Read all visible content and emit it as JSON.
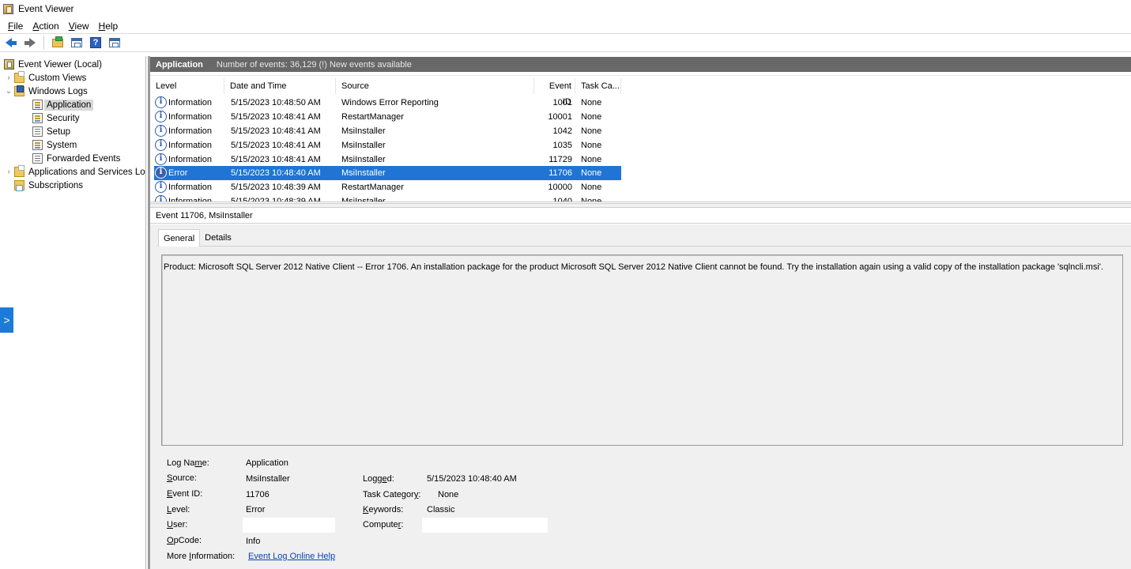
{
  "window": {
    "title": "Event Viewer"
  },
  "menu": [
    {
      "label": "File",
      "key": "F",
      "rest": "ile"
    },
    {
      "label": "Action",
      "key": "A",
      "rest": "ction"
    },
    {
      "label": "View",
      "key": "V",
      "rest": "iew"
    },
    {
      "label": "Help",
      "key": "H",
      "rest": "elp"
    }
  ],
  "toolbar": {
    "icons": [
      "back-arrow-icon",
      "forward-arrow-icon",
      "open-folder-icon",
      "properties-icon",
      "help-icon",
      "show-hide-pane-icon"
    ],
    "help_glyph": "?"
  },
  "tree": {
    "root": "Event Viewer (Local)",
    "custom_views": "Custom Views",
    "windows_logs": "Windows Logs",
    "application": "Application",
    "security": "Security",
    "setup": "Setup",
    "system": "System",
    "forwarded_events": "Forwarded Events",
    "apps_services": "Applications and Services Logs",
    "subscriptions": "Subscriptions",
    "collapsed_glyph": "›",
    "expanded_glyph": "⌄"
  },
  "side_expander_glyph": ">",
  "header": {
    "title": "Application",
    "info": "Number of events: 36,129 (!) New events available"
  },
  "columns": {
    "level": "Level",
    "datetime": "Date and Time",
    "source": "Source",
    "event_id": "Event ID",
    "task_category": "Task Ca..."
  },
  "events": [
    {
      "level": "Information",
      "datetime": "5/15/2023 10:48:50 AM",
      "source": "Windows Error Reporting",
      "event_id": "1001",
      "task": "None"
    },
    {
      "level": "Information",
      "datetime": "5/15/2023 10:48:41 AM",
      "source": "RestartManager",
      "event_id": "10001",
      "task": "None"
    },
    {
      "level": "Information",
      "datetime": "5/15/2023 10:48:41 AM",
      "source": "MsiInstaller",
      "event_id": "1042",
      "task": "None"
    },
    {
      "level": "Information",
      "datetime": "5/15/2023 10:48:41 AM",
      "source": "MsiInstaller",
      "event_id": "1035",
      "task": "None"
    },
    {
      "level": "Information",
      "datetime": "5/15/2023 10:48:41 AM",
      "source": "MsiInstaller",
      "event_id": "11729",
      "task": "None"
    },
    {
      "level": "Error",
      "datetime": "5/15/2023 10:48:40 AM",
      "source": "MsiInstaller",
      "event_id": "11706",
      "task": "None"
    },
    {
      "level": "Information",
      "datetime": "5/15/2023 10:48:39 AM",
      "source": "RestartManager",
      "event_id": "10000",
      "task": "None"
    },
    {
      "level": "Information",
      "datetime": "5/15/2023 10:48:39 AM",
      "source": "MsiInstaller",
      "event_id": "1040",
      "task": "None"
    }
  ],
  "info_glyph": "i",
  "detail": {
    "title": "Event 11706, MsiInstaller",
    "tab_general": "General",
    "tab_details": "Details",
    "description": "Product: Microsoft SQL Server 2012 Native Client  -- Error 1706. An installation package for the product Microsoft SQL Server 2012 Native Client  cannot be found. Try the installation again using a valid copy of the installation package 'sqlncli.msi'.",
    "labels": {
      "log_name": {
        "pre": "Log Na",
        "key": "m",
        "post": "e:"
      },
      "source": {
        "pre": "",
        "key": "S",
        "post": "ource:"
      },
      "event_id": {
        "pre": "",
        "key": "E",
        "post": "vent ID:"
      },
      "level": {
        "pre": "",
        "key": "L",
        "post": "evel:"
      },
      "user": {
        "pre": "",
        "key": "U",
        "post": "ser:"
      },
      "opcode": {
        "pre": "",
        "key": "O",
        "post": "pCode:"
      },
      "more_info": {
        "pre": "More ",
        "key": "I",
        "post": "nformation:"
      },
      "logged": {
        "pre": "Logg",
        "key": "e",
        "post": "d:"
      },
      "task_category": {
        "pre": "Task Categor",
        "key": "y",
        "post": ":"
      },
      "keywords": {
        "pre": "",
        "key": "K",
        "post": "eywords:"
      },
      "computer": {
        "pre": "Compute",
        "key": "r",
        "post": ":"
      }
    },
    "values": {
      "log_name": "Application",
      "source": "MsiInstaller",
      "event_id": "11706",
      "level": "Error",
      "user": "",
      "opcode": "Info",
      "more_info_link": "Event Log Online Help",
      "logged": "5/15/2023 10:48:40 AM",
      "task_category": "None",
      "keywords": "Classic",
      "computer": ""
    }
  }
}
